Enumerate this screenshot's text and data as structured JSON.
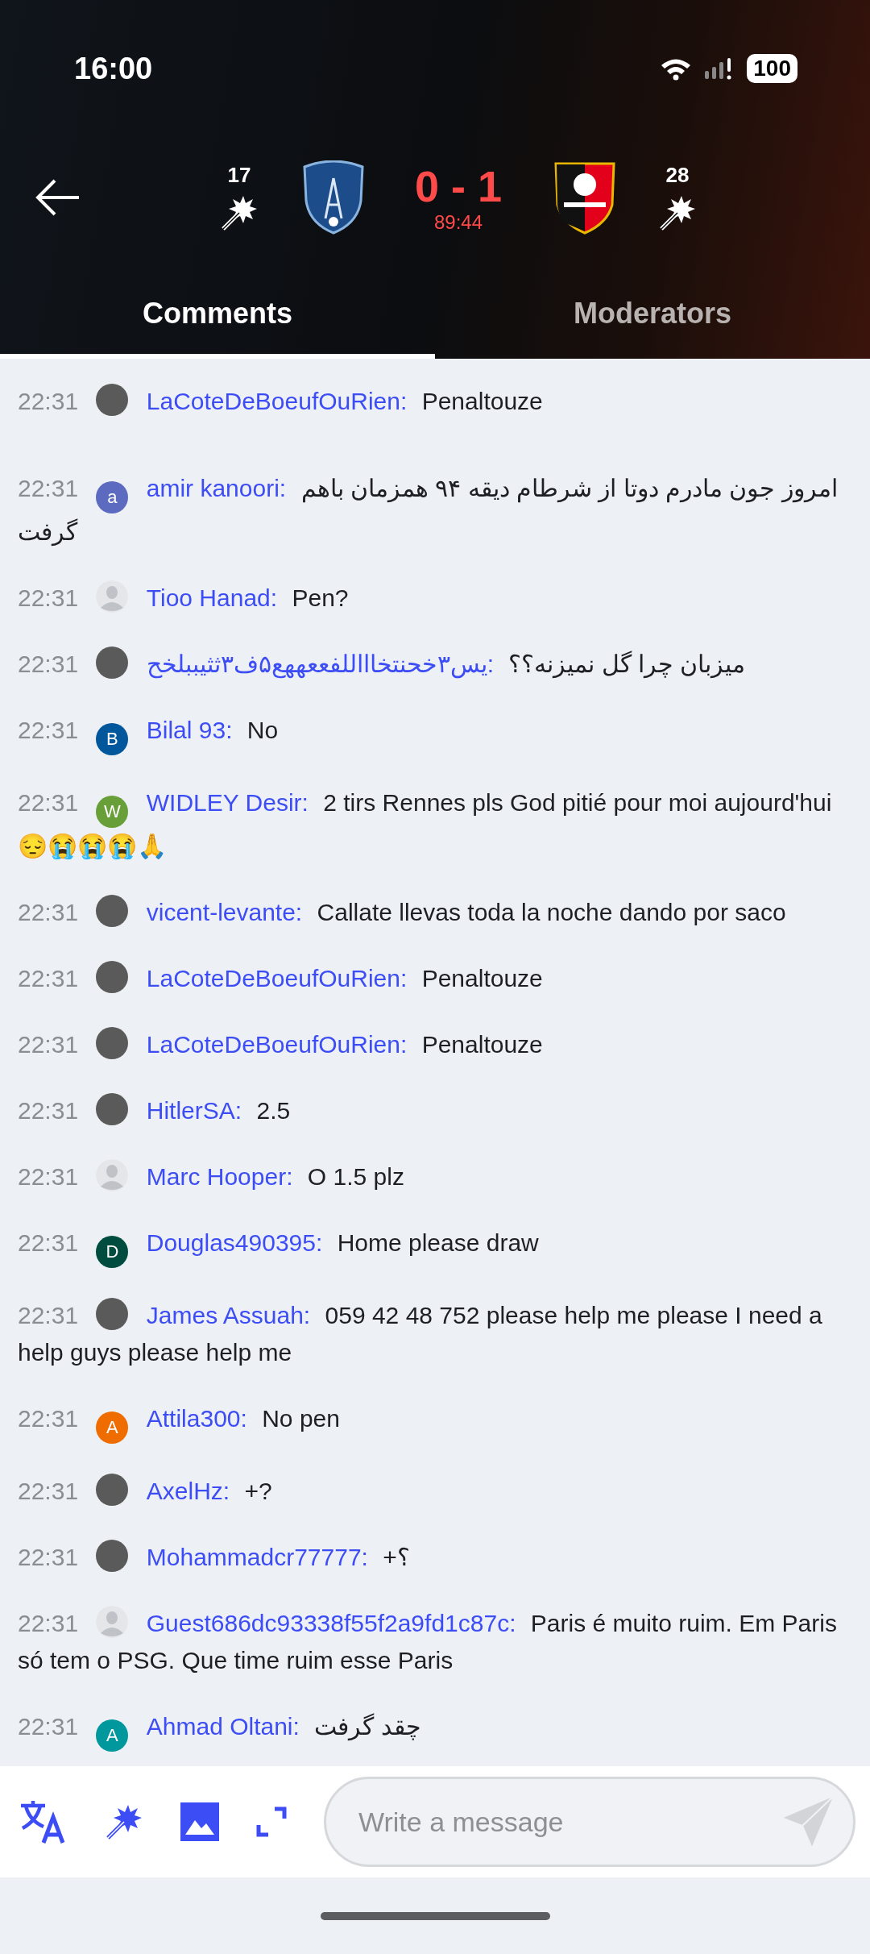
{
  "status_bar": {
    "time": "16:00",
    "battery": "100"
  },
  "match": {
    "home": {
      "count": "17"
    },
    "score": "0 - 1",
    "clock": "89:44",
    "away": {
      "count": "28"
    }
  },
  "tabs": [
    {
      "label": "Comments",
      "selected": true
    },
    {
      "label": "Moderators",
      "selected": false
    }
  ],
  "comments": [
    {
      "time": "22:31",
      "avatar": {
        "kind": "photo"
      },
      "name": "LaCoteDeBoeufOuRien:",
      "text": "Penaltouze"
    },
    {
      "time": "22:31",
      "avatar": {
        "kind": "letter",
        "letter": "a",
        "color": "#5c6bc0"
      },
      "name": "amir kanoori:",
      "text": "امروز جون مادرم دوتا از شرطام دیقه ۹۴ همزمان باهم گرفت"
    },
    {
      "time": "22:31",
      "avatar": {
        "kind": "guest"
      },
      "name": "Tioo Hanad:",
      "text": "Pen?"
    },
    {
      "time": "22:31",
      "avatar": {
        "kind": "photo"
      },
      "name": "یس۳خحنتخاااللفععههع۵ف۳ثثیببلخح:",
      "text": "میزبان چرا گل نمیزنه؟؟"
    },
    {
      "time": "22:31",
      "avatar": {
        "kind": "letter",
        "letter": "B",
        "color": "#01579b"
      },
      "name": "Bilal 93:",
      "text": "No"
    },
    {
      "time": "22:31",
      "avatar": {
        "kind": "letter",
        "letter": "W",
        "color": "#689f38"
      },
      "name": "WIDLEY Desir:",
      "text": "2 tirs Rennes pls God pitié pour moi aujourd'hui 😔😭😭😭🙏"
    },
    {
      "time": "22:31",
      "avatar": {
        "kind": "photo"
      },
      "name": "vicent-levante:",
      "text": "Callate  llevas toda la noche dando por saco"
    },
    {
      "time": "22:31",
      "avatar": {
        "kind": "photo"
      },
      "name": "LaCoteDeBoeufOuRien:",
      "text": "Penaltouze"
    },
    {
      "time": "22:31",
      "avatar": {
        "kind": "photo"
      },
      "name": "LaCoteDeBoeufOuRien:",
      "text": "Penaltouze"
    },
    {
      "time": "22:31",
      "avatar": {
        "kind": "photo"
      },
      "name": "HitlerSA:",
      "text": "2.5"
    },
    {
      "time": "22:31",
      "avatar": {
        "kind": "guest"
      },
      "name": "Marc Hooper:",
      "text": "O 1.5 plz"
    },
    {
      "time": "22:31",
      "avatar": {
        "kind": "letter",
        "letter": "D",
        "color": "#004d40"
      },
      "name": "Douglas490395:",
      "text": "Home please draw"
    },
    {
      "time": "22:31",
      "avatar": {
        "kind": "photo"
      },
      "name": "James Assuah:",
      "text": "059 42 48 752 please help me please I need a help guys please help me"
    },
    {
      "time": "22:31",
      "avatar": {
        "kind": "letter",
        "letter": "A",
        "color": "#ef6c00"
      },
      "name": "Attila300:",
      "text": "No pen"
    },
    {
      "time": "22:31",
      "avatar": {
        "kind": "photo"
      },
      "name": "AxelHz:",
      "text": "+?"
    },
    {
      "time": "22:31",
      "avatar": {
        "kind": "photo"
      },
      "name": "Mohammadcr77777:",
      "text": "+؟"
    },
    {
      "time": "22:31",
      "avatar": {
        "kind": "guest"
      },
      "name": "Guest686dc93338f55f2a9fd1c87c:",
      "text": "Paris é muito ruim. Em Paris só tem o PSG. Que time ruim esse Paris"
    },
    {
      "time": "22:31",
      "avatar": {
        "kind": "letter",
        "letter": "A",
        "color": "#00979d"
      },
      "name": "Ahmad Oltani:",
      "text": "چقد گرفت"
    }
  ],
  "composer": {
    "placeholder": "Write a message"
  }
}
